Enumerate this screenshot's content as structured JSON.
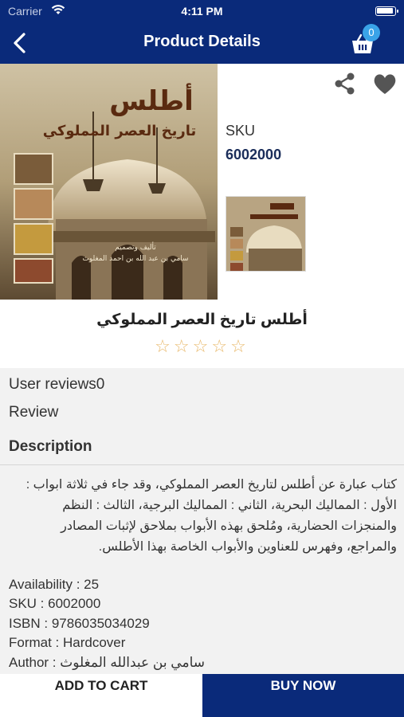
{
  "status": {
    "carrier": "Carrier",
    "time": "4:11 PM"
  },
  "nav": {
    "title": "Product Details",
    "cart_count": "0"
  },
  "product": {
    "sku_label": "SKU",
    "sku_value": "6002000",
    "title": "أطلس تاريخ العصر المملوكي",
    "rating": 0,
    "rating_max": 5,
    "cover_title": "أطلس",
    "cover_subtitle": "تاريخ العصر المملوكي",
    "cover_author_line": "سامي بن عبد الله بن احمد المغلوث",
    "cover_byline": "تأليف وتصميم"
  },
  "reviews": {
    "user_reviews_label": "User reviews0",
    "review_label": "Review"
  },
  "description": {
    "heading": "Description",
    "text": "كتاب عبارة عن أطلس لتاريخ العصر المملوكي، وقد جاء في ثلاثة ابواب : الأول : المماليك البحرية، الثاني : المماليك البرجية، الثالث : النظم والمنجزات الحضارية، ومُلحق بهذه الأبواب بملاحق لإثبات المصادر والمراجع، وفهرس للعناوين والأبواب الخاصة بهذا الأطلس."
  },
  "details": {
    "availability": "Availability : 25",
    "sku": "SKU : 6002000",
    "isbn": "ISBN : 9786035034029",
    "format": "Format : Hardcover",
    "author": "Author : سامي بن عبدالله المغلوث"
  },
  "actions": {
    "add_to_cart": "ADD TO CART",
    "buy_now": "BUY NOW"
  },
  "colors": {
    "nav_bg": "#0a2a7a",
    "badge": "#3aa3e8",
    "star": "#e8b86a",
    "section_bg": "#f2f2f2"
  }
}
